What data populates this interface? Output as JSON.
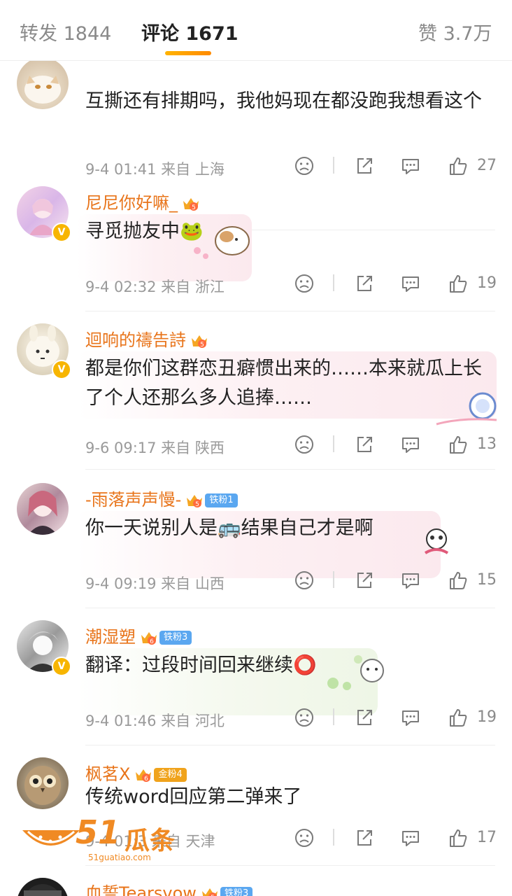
{
  "tabs": [
    {
      "label": "转发 1844"
    },
    {
      "label": "评论 1671"
    },
    {
      "label": "赞 3.7万"
    }
  ],
  "comments": [
    {
      "text": "互撕还有排期吗，我他妈现在都没跑我想看这个",
      "meta": "9-4 01:41 来自 上海",
      "likes": "27"
    },
    {
      "username": "尼尼你好嘛_",
      "text": "寻觅抛友中🐸",
      "meta": "9-4 02:32 来自 浙江",
      "likes": "19"
    },
    {
      "username": "迴响的禱告詩",
      "text": "都是你们这群恋丑癖惯出来的……本来就瓜上长了个人还那么多人追捧……",
      "meta": "9-6 09:17 来自 陕西",
      "likes": "13"
    },
    {
      "username": "-雨落声声慢-",
      "fan_badge": "铁粉1",
      "text": "你一天说别人是🚌结果自己才是啊",
      "meta": "9-4 09:19 来自 山西",
      "likes": "15"
    },
    {
      "username": "潮湿塑",
      "fan_badge": "铁粉3",
      "text": "翻译：过段时间回来继续⭕",
      "meta": "9-4 01:46 来自 河北",
      "likes": "19"
    },
    {
      "username": "枫茗X",
      "fan_badge": "金粉4",
      "text": "传统word回应第二弹来了",
      "meta": "9-4 01:3 来自 天津",
      "likes": "17"
    },
    {
      "username": "血誓Tearsvow",
      "fan_badge": "铁粉3"
    }
  ],
  "watermark": {
    "number": "51",
    "text": "瓜条",
    "url": "51guatiao.com"
  },
  "colors": {
    "accent": "#ff9a00",
    "username": "#e8741a",
    "meta": "#9a9a9a"
  }
}
